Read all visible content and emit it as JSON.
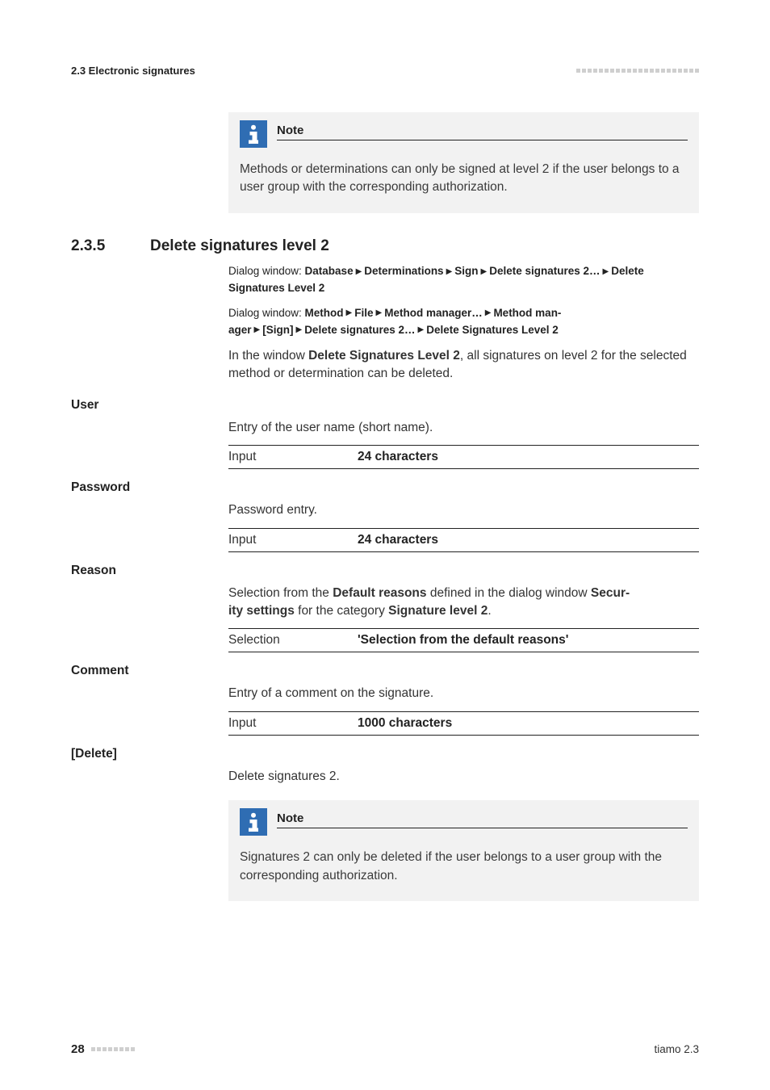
{
  "header": {
    "left": "2.3 Electronic signatures"
  },
  "note_top": {
    "title": "Note",
    "body": "Methods or determinations can only be signed at level 2 if the user belongs to a user group with the corresponding authorization."
  },
  "section": {
    "number": "2.3.5",
    "title": "Delete signatures level 2",
    "dlg1": {
      "lead": "Dialog window: ",
      "p1": "Database",
      "p2": "Determinations",
      "p3": "Sign",
      "p4": "Delete signatures 2…",
      "p5": "Delete Signatures Level 2"
    },
    "dlg2": {
      "lead": "Dialog window: ",
      "p1": "Method",
      "p2": "File",
      "p3": "Method manager…",
      "p4a": "Method man-",
      "p4b": "ager",
      "p5": "[Sign]",
      "p6": "Delete signatures 2…",
      "p7": "Delete Signatures Level 2"
    },
    "intro_a": "In the window ",
    "intro_b": "Delete Signatures Level 2",
    "intro_c": ", all signatures on level 2 for the selected method or determination can be deleted."
  },
  "fields": {
    "user": {
      "label": "User",
      "desc": "Entry of the user name (short name).",
      "kv_key": "Input",
      "kv_val": "24 characters"
    },
    "password": {
      "label": "Password",
      "desc": "Password entry.",
      "kv_key": "Input",
      "kv_val": "24 characters"
    },
    "reason": {
      "label": "Reason",
      "desc_a": "Selection from the ",
      "desc_b": "Default reasons",
      "desc_c": " defined in the dialog window ",
      "desc_d": "Secur-",
      "desc_e": "ity settings",
      "desc_f": " for the category ",
      "desc_g": "Signature level 2",
      "desc_h": ".",
      "kv_key": "Selection",
      "kv_val": "'Selection from the default reasons'"
    },
    "comment": {
      "label": "Comment",
      "desc": "Entry of a comment on the signature.",
      "kv_key": "Input",
      "kv_val": "1000 characters"
    },
    "delete": {
      "label": "[Delete]",
      "desc": "Delete signatures 2."
    }
  },
  "note_bottom": {
    "title": "Note",
    "body": "Signatures 2 can only be deleted if the user belongs to a user group with the corresponding authorization."
  },
  "footer": {
    "page": "28",
    "product": "tiamo 2.3"
  }
}
